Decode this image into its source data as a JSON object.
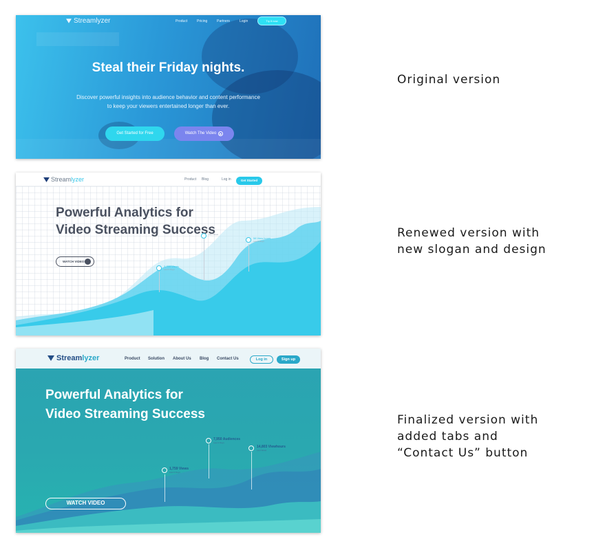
{
  "versions": [
    {
      "caption": "Original version",
      "logo": "Streamlyzer",
      "nav": [
        "Product",
        "Pricing",
        "Partners",
        "Login"
      ],
      "cta": "Try it now",
      "headline": "Steal their Friday nights.",
      "subtext": "Discover powerful insights into audience behavior and content performance to keep your viewers entertained longer than ever.",
      "primary_button": "Get Started for Free",
      "secondary_button": "Watch The Video"
    },
    {
      "caption": "Renewed version with\nnew slogan and design",
      "logo_prefix": "Stream",
      "logo_suffix": "lyzer",
      "nav": [
        "Product",
        "Blog",
        "Log in"
      ],
      "cta": "Get Started",
      "headline_line1": "Powerful Analytics for",
      "headline_line2": "Video Streaming Success",
      "watch_button": "WATCH VIDEO",
      "stats": [
        {
          "value": "3,759 Views",
          "note": "Last 3 Days"
        },
        {
          "value": "",
          "note": "Last Week"
        },
        {
          "value": "58 View hours",
          "note": "Last 3 Days"
        }
      ]
    },
    {
      "caption": "Finalized version with\nadded tabs and\n“Contact Us” button",
      "logo_prefix": "Stream",
      "logo_suffix": "lyzer",
      "nav": [
        "Product",
        "Solution",
        "About Us",
        "Blog",
        "Contact Us"
      ],
      "login": "Log in",
      "signup": "Sign up",
      "headline_line1": "Powerful Analytics for",
      "headline_line2": "Video Streaming Success",
      "watch_button": "WATCH VIDEO",
      "stats": [
        {
          "value": "1,759 Views",
          "note": "Last 3 Days"
        },
        {
          "value": "7,950 Audiences",
          "note": "Last 3 Days"
        },
        {
          "value": "14,803 Viewhours",
          "note": "Last Week"
        }
      ]
    }
  ]
}
